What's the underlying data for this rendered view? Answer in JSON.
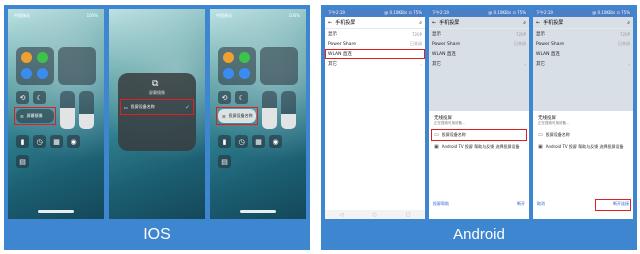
{
  "captions": {
    "ios": "IOS",
    "android": "Android"
  },
  "ios": {
    "status": {
      "carrier": "中国移动",
      "battery": "100%"
    },
    "mirror_label": "屏幕镜像",
    "popup": {
      "title": "屏幕镜像",
      "device": "投屏设备名称"
    }
  },
  "android": {
    "status": {
      "time": "下午2:19",
      "icons": "@ 0.10KB/s ⊡ 75%"
    },
    "header_title": "手机投屏",
    "search_icon": "⌕",
    "rows": [
      {
        "label": "显示",
        "value": "720P"
      },
      {
        "label": "Power Share",
        "value": "已关闭"
      },
      {
        "label": "WLAN 直连",
        "value": ""
      },
      {
        "label": "其它",
        "value": ""
      }
    ],
    "sheet": {
      "title": "无线投屏",
      "subtitle": "正在搜索可用设备…",
      "item1": "投屏设备名称",
      "item2": "Android TV 投屏 帮助与反馈 选择投屏设备"
    },
    "buttons": {
      "left": "投屏帮助",
      "right": "断开"
    },
    "buttons3": {
      "left": "取消",
      "right": "断开连接"
    }
  },
  "colors": {
    "panel_bg": "#3f86d0",
    "highlight": "#e02020"
  }
}
